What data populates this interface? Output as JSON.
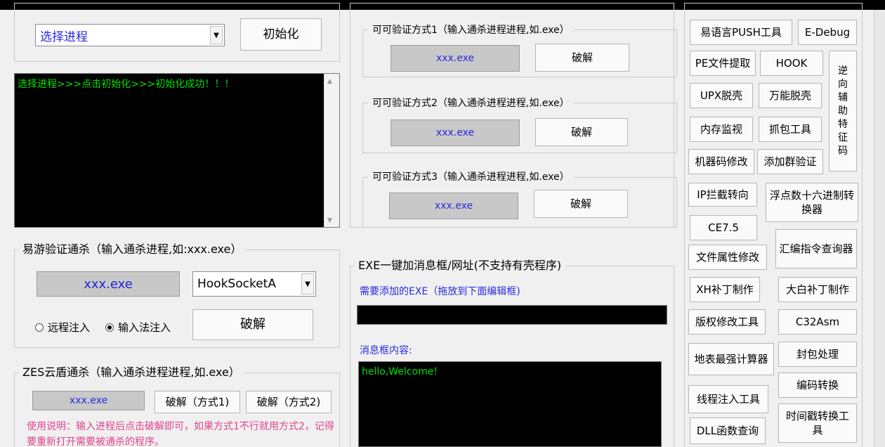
{
  "process_group": {
    "title": "",
    "select_value": "选择进程",
    "init_label": "初始化"
  },
  "console": {
    "log": "选择进程>>>点击初始化>>>初始化成功！！！"
  },
  "yiyou": {
    "title": "易游验证通杀（输入通杀进程,如:xxx.exe）",
    "field_value": "xxx.exe",
    "hook_select": "HookSocketA",
    "radio_remote": "远程注入",
    "radio_ime": "输入法注入",
    "crack_label": "破解"
  },
  "zes": {
    "title": "ZES云盾通杀（输入通杀进程进程,如.exe）",
    "field_value": "xxx.exe",
    "crack1_label": "破解（方式1)",
    "crack2_label": "破解（方式2)",
    "instructions": "使用说明：输入进程后点击破解即可，如果方式1不行就用方式2，记得要重新打开需要被通杀的程序。"
  },
  "verify": {
    "methods": [
      {
        "title": "可可验证方式1（输入通杀进程进程,如.exe）",
        "field": "xxx.exe",
        "button": "破解"
      },
      {
        "title": "可可验证方式2（输入通杀进程进程,如.exe）",
        "field": "xxx.exe",
        "button": "破解"
      },
      {
        "title": "可可验证方式3（输入通杀进程进程,如.exe）",
        "field": "xxx.exe",
        "button": "破解"
      }
    ]
  },
  "exe_msg": {
    "title": "EXE一键加消息框/网址(不支持有壳程序)",
    "exe_label": "需要添加的EXE（拖放到下面编辑框)",
    "msg_label": "消息框内容:",
    "msg_value": "hello,Welcome!"
  },
  "tools": {
    "push": "易语言PUSH工具",
    "edebug": "E-Debug",
    "pe": "PE文件提取",
    "hook": "HOOK",
    "reverse": [
      "逆",
      "向",
      "辅",
      "助",
      "特",
      "征",
      "码"
    ],
    "upx": "UPX脱壳",
    "universal": "万能脱壳",
    "memory": "内存监视",
    "capture": "抓包工具",
    "machine_code": "机器码修改",
    "add_group": "添加群验证",
    "ip_redirect": "IP拦截转向",
    "float_hex": "浮点数十六进制转换器",
    "ce": "CE7.5",
    "asm_query": "汇编指令查询器",
    "file_attr": "文件属性修改",
    "xh_patch": "XH补丁制作",
    "dabai_patch": "大白补丁制作",
    "copyright": "版权修改工具",
    "c32asm": "C32Asm",
    "calc": "地表最强计算器",
    "packet": "封包处理",
    "encode": "编码转换",
    "thread_inject": "线程注入工具",
    "timestamp": "时间戳转换工具",
    "dll_query": "DLL函数查询"
  }
}
